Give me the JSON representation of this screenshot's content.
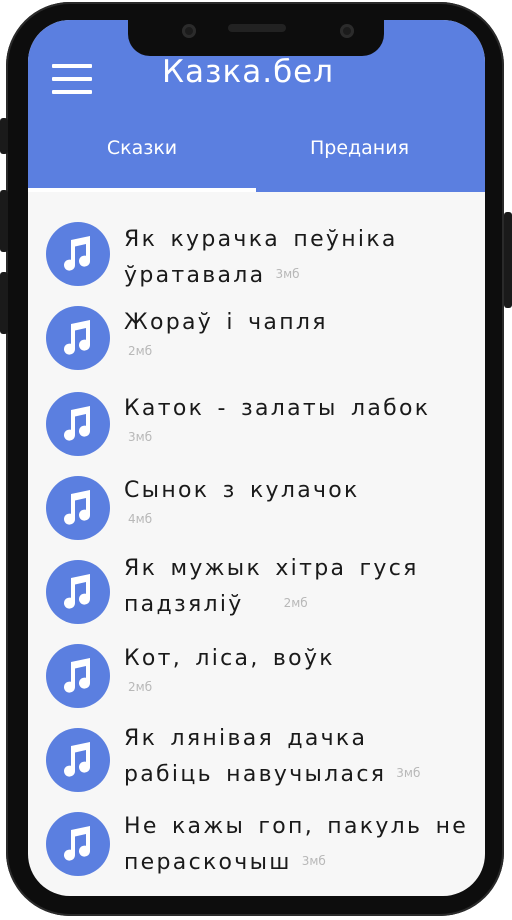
{
  "header": {
    "title": "Казка.бел",
    "accent_color": "#5b7fe0",
    "menu_icon": "hamburger-menu-icon"
  },
  "tabs": [
    {
      "label": "Сказки",
      "selected": true
    },
    {
      "label": "Предания",
      "selected": false
    }
  ],
  "stories": [
    {
      "title": "Як курачка пеўніка ўратавала",
      "size": "3мб",
      "icon": "music-note-icon"
    },
    {
      "title": "Жораў і чапля",
      "size": "2мб",
      "icon": "music-note-icon"
    },
    {
      "title": "Каток - залаты лабок",
      "size": "3мб",
      "icon": "music-note-icon"
    },
    {
      "title": "Сынок з кулачок",
      "size": "4мб",
      "icon": "music-note-icon"
    },
    {
      "title": "Як мужык хітра гуся падзяліў",
      "size": "2мб",
      "icon": "music-note-icon"
    },
    {
      "title": "Кот, ліса, воўк",
      "size": "2мб",
      "icon": "music-note-icon"
    },
    {
      "title": "Як лянівая дачка рабіць навучылася",
      "size": "3мб",
      "icon": "music-note-icon"
    },
    {
      "title": "Не кажы гоп, пакуль не пераскочыш",
      "size": "3мб",
      "icon": "music-note-icon"
    }
  ]
}
